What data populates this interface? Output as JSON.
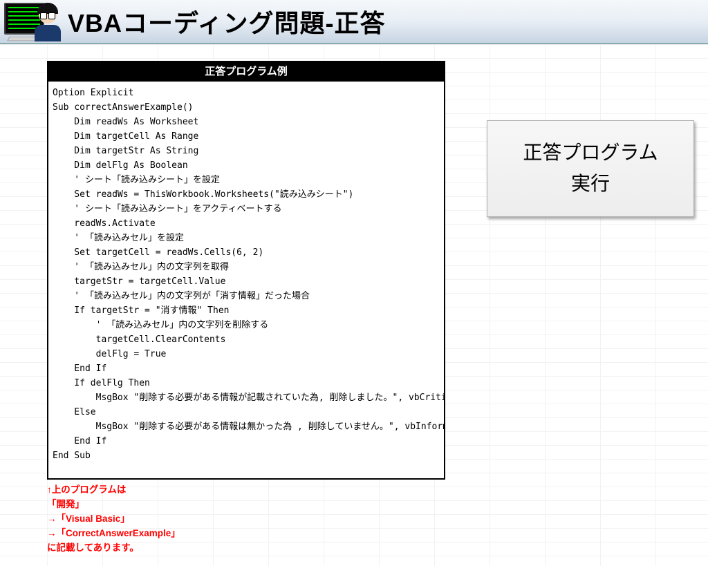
{
  "header": {
    "title": "VBAコーディング問題-正答"
  },
  "code": {
    "title": "正答プログラム例",
    "lines": [
      "Option Explicit",
      "",
      "Sub correctAnswerExample()",
      "    Dim readWs As Worksheet",
      "    Dim targetCell As Range",
      "    Dim targetStr As String",
      "    Dim delFlg As Boolean",
      "    ' シート「読み込みシート」を設定",
      "    Set readWs = ThisWorkbook.Worksheets(\"読み込みシート\")",
      "    ' シート「読み込みシート」をアクティベートする",
      "    readWs.Activate",
      "    ' 「読み込みセル」を設定",
      "    Set targetCell = readWs.Cells(6, 2)",
      "    ' 「読み込みセル」内の文字列を取得",
      "    targetStr = targetCell.Value",
      "    ' 「読み込みセル」内の文字列が「消す情報」だった場合",
      "    If targetStr = \"消す情報\" Then",
      "        ' 「読み込みセル」内の文字列を削除する",
      "        targetCell.ClearContents",
      "        delFlg = True",
      "    End If",
      "    If delFlg Then",
      "        MsgBox \"削除する必要がある情報が記載されていた為, 削除しました。\", vbCritical",
      "    Else",
      "        MsgBox \"削除する必要がある情報は無かった為 , 削除していません。\", vbInformation",
      "    End If",
      "End Sub"
    ]
  },
  "notes": [
    "↑上のプログラムは",
    "「開発」",
    "→「Visual Basic」",
    "→「CorrectAnswerExample」",
    "に記載してあります。"
  ],
  "button": {
    "label": "正答プログラム\n実行"
  }
}
